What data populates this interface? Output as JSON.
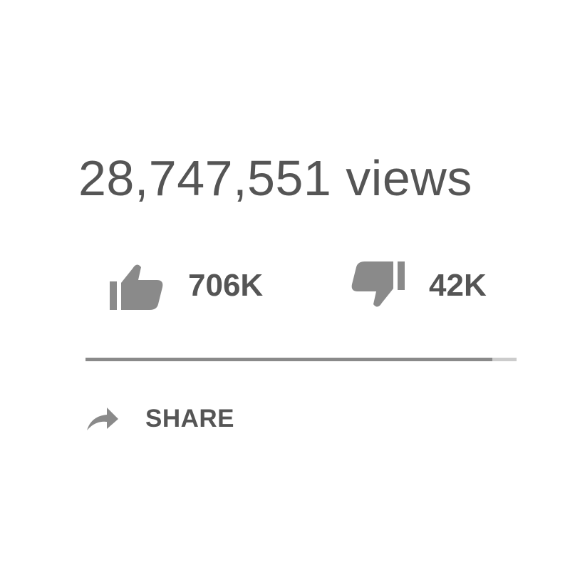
{
  "video": {
    "view_count": "28,747,551 views"
  },
  "rating": {
    "likes_label": "706K",
    "dislikes_label": "42K",
    "like_ratio": 0.944
  },
  "actions": {
    "share_label": "SHARE"
  },
  "icons": {
    "like": "thumbs-up-icon",
    "dislike": "thumbs-down-icon",
    "share": "share-arrow-icon"
  },
  "colors": {
    "text": "#555555",
    "icon": "#8a8a8a",
    "bar_fill": "#8a8a8a",
    "bar_track": "#cccccc"
  }
}
